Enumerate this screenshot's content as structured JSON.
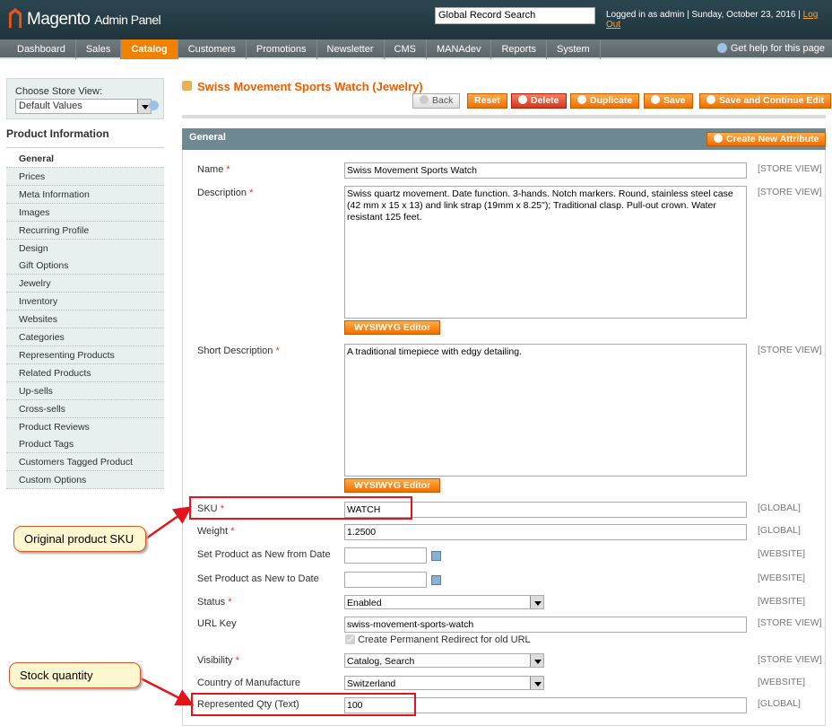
{
  "header": {
    "logo": "Magento",
    "logo_sub": "Admin Panel",
    "search_value": "Global Record Search",
    "logged_in": "Logged in as admin",
    "date": "Sunday, October 23, 2016",
    "logout": "Log Out"
  },
  "nav": {
    "items": [
      "Dashboard",
      "Sales",
      "Catalog",
      "Customers",
      "Promotions",
      "Newsletter",
      "CMS",
      "MANAdev",
      "Reports",
      "System"
    ],
    "active": "Catalog",
    "help": "Get help for this page"
  },
  "store": {
    "label": "Choose Store View:",
    "value": "Default Values"
  },
  "sidebar": {
    "title": "Product Information",
    "items": [
      "General",
      "Prices",
      "Meta Information",
      "Images",
      "Recurring Profile",
      "Design",
      "Gift Options",
      "Jewelry",
      "Inventory",
      "Websites",
      "Categories",
      "Representing Products",
      "Related Products",
      "Up-sells",
      "Cross-sells",
      "Product Reviews",
      "Product Tags",
      "Customers Tagged Product",
      "Custom Options"
    ],
    "active": "General"
  },
  "page": {
    "title": "Swiss Movement Sports Watch (Jewelry)",
    "buttons": {
      "back": "Back",
      "reset": "Reset",
      "delete": "Delete",
      "duplicate": "Duplicate",
      "save": "Save",
      "save_continue": "Save and Continue Edit"
    }
  },
  "section": {
    "title": "General",
    "create_attr": "Create New Attribute",
    "wysiwyg": "WYSIWYG Editor"
  },
  "fields": {
    "name": {
      "label": "Name",
      "value": "Swiss Movement Sports Watch",
      "scope": "[STORE VIEW]"
    },
    "description": {
      "label": "Description",
      "value": "Swiss quartz movement. Date function. 3-hands. Notch markers. Round, stainless steel case (42 mm x 15 x 13) and link strap (19mm x 8.25\"); Traditional clasp. Pull-out crown. Water resistant 125 feet.",
      "scope": "[STORE VIEW]"
    },
    "short_description": {
      "label": "Short Description",
      "value": "A traditional timepiece with edgy detailing.",
      "scope": "[STORE VIEW]"
    },
    "sku": {
      "label": "SKU",
      "value": "WATCH",
      "scope": "[GLOBAL]"
    },
    "weight": {
      "label": "Weight",
      "value": "1.2500",
      "scope": "[GLOBAL]"
    },
    "new_from": {
      "label": "Set Product as New from Date",
      "value": "",
      "scope": "[WEBSITE]"
    },
    "new_to": {
      "label": "Set Product as New to Date",
      "value": "",
      "scope": "[WEBSITE]"
    },
    "status": {
      "label": "Status",
      "value": "Enabled",
      "scope": "[WEBSITE]"
    },
    "url_key": {
      "label": "URL Key",
      "value": "swiss-movement-sports-watch",
      "scope": "[STORE VIEW]",
      "redirect_label": "Create Permanent Redirect for old URL",
      "redirect_checked": true
    },
    "visibility": {
      "label": "Visibility",
      "value": "Catalog, Search",
      "scope": "[STORE VIEW]"
    },
    "country": {
      "label": "Country of Manufacture",
      "value": "Switzerland",
      "scope": "[WEBSITE]"
    },
    "represented_qty": {
      "label": "Represented Qty (Text)",
      "value": "100",
      "scope": "[GLOBAL]"
    }
  },
  "annotations": {
    "sku_callout": "Original product SKU",
    "qty_callout": "Stock quantity",
    "highlight_color": "#e3141b"
  }
}
